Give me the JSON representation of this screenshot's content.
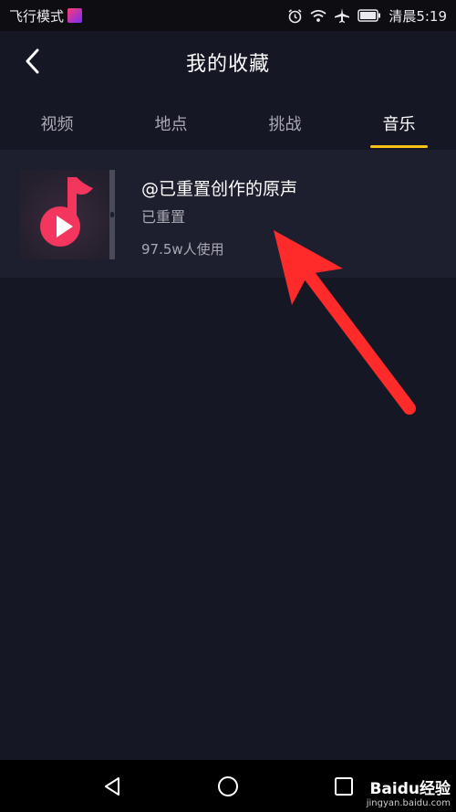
{
  "status_bar": {
    "mode_text": "飞行模式",
    "time_text": "清晨5:19",
    "icons": [
      "app-badge-icon",
      "alarm-icon",
      "wifi-icon",
      "airplane-icon",
      "battery-icon"
    ]
  },
  "header": {
    "title": "我的收藏",
    "back_icon": "chevron-left-icon"
  },
  "tabs": [
    {
      "label": "视频",
      "active": false
    },
    {
      "label": "地点",
      "active": false
    },
    {
      "label": "挑战",
      "active": false
    },
    {
      "label": "音乐",
      "active": true
    }
  ],
  "colors": {
    "background": "#161724",
    "list_item_bg": "#1e1f2e",
    "tab_indicator": "#f6c218",
    "accent_red": "#ff2a2a",
    "music_note": "#f2365d"
  },
  "music_items": [
    {
      "title": "@已重置创作的原声",
      "author": "已重置",
      "usage": "97.5w人使用",
      "cover_icon": "music-note-play-icon"
    }
  ],
  "nav_bar": {
    "icons": [
      "back-triangle-icon",
      "home-circle-icon",
      "recents-square-icon"
    ]
  },
  "watermark": {
    "brand": "Baidu经验",
    "url": "jingyan.baidu.com"
  }
}
